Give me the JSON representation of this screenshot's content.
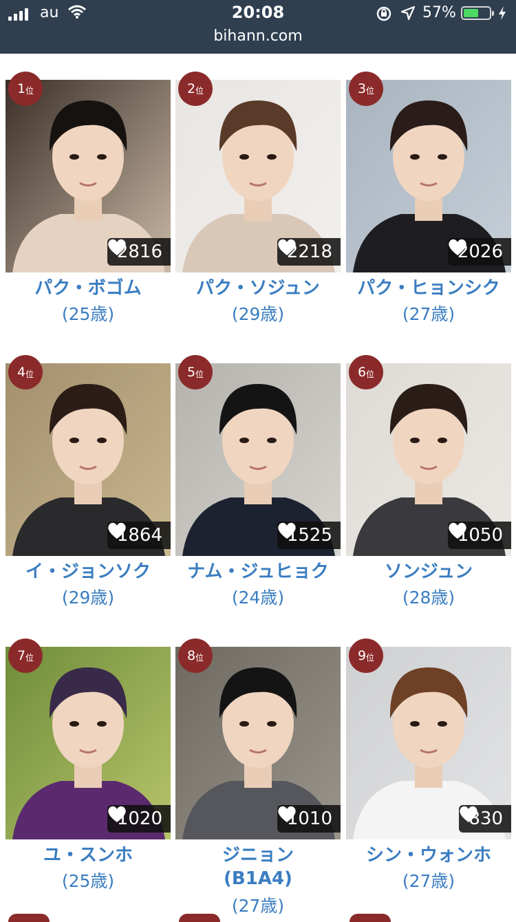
{
  "status_bar": {
    "carrier": "au",
    "time": "20:08",
    "battery_percent": "57%",
    "battery_level": 0.57
  },
  "address_bar": {
    "url": "bihann.com"
  },
  "ranking": {
    "rank_unit": "位",
    "items": [
      {
        "rank": "1",
        "likes": "2816",
        "name": "パク・ボゴム",
        "name2": "",
        "age": "(25歳)"
      },
      {
        "rank": "2",
        "likes": "2218",
        "name": "パク・ソジュン",
        "name2": "",
        "age": "(29歳)"
      },
      {
        "rank": "3",
        "likes": "2026",
        "name": "パク・ヒョンシク",
        "name2": "",
        "age": "(27歳)"
      },
      {
        "rank": "4",
        "likes": "1864",
        "name": "イ・ジョンソク",
        "name2": "",
        "age": "(29歳)"
      },
      {
        "rank": "5",
        "likes": "1525",
        "name": "ナム・ジュヒョク",
        "name2": "",
        "age": "(24歳)"
      },
      {
        "rank": "6",
        "likes": "1050",
        "name": "ソンジュン",
        "name2": "",
        "age": "(28歳)"
      },
      {
        "rank": "7",
        "likes": "1020",
        "name": "ユ・スンホ",
        "name2": "",
        "age": "(25歳)"
      },
      {
        "rank": "8",
        "likes": "1010",
        "name": "ジニョン",
        "name2": "(B1A4)",
        "age": "(27歳)"
      },
      {
        "rank": "9",
        "likes": "830",
        "name": "シン・ウォンホ",
        "name2": "",
        "age": "(27歳)"
      }
    ]
  },
  "icons": {
    "heart": "heart-icon",
    "wifi": "wifi-icon",
    "location": "location-arrow-icon",
    "orientation_lock": "orientation-lock-icon",
    "charging": "charging-bolt-icon"
  },
  "colors": {
    "topbar": "#2f3f50",
    "rank_badge": "#8b2a2a",
    "name_text": "#3a7dc1",
    "likes_bg": "#0f0f0f"
  }
}
